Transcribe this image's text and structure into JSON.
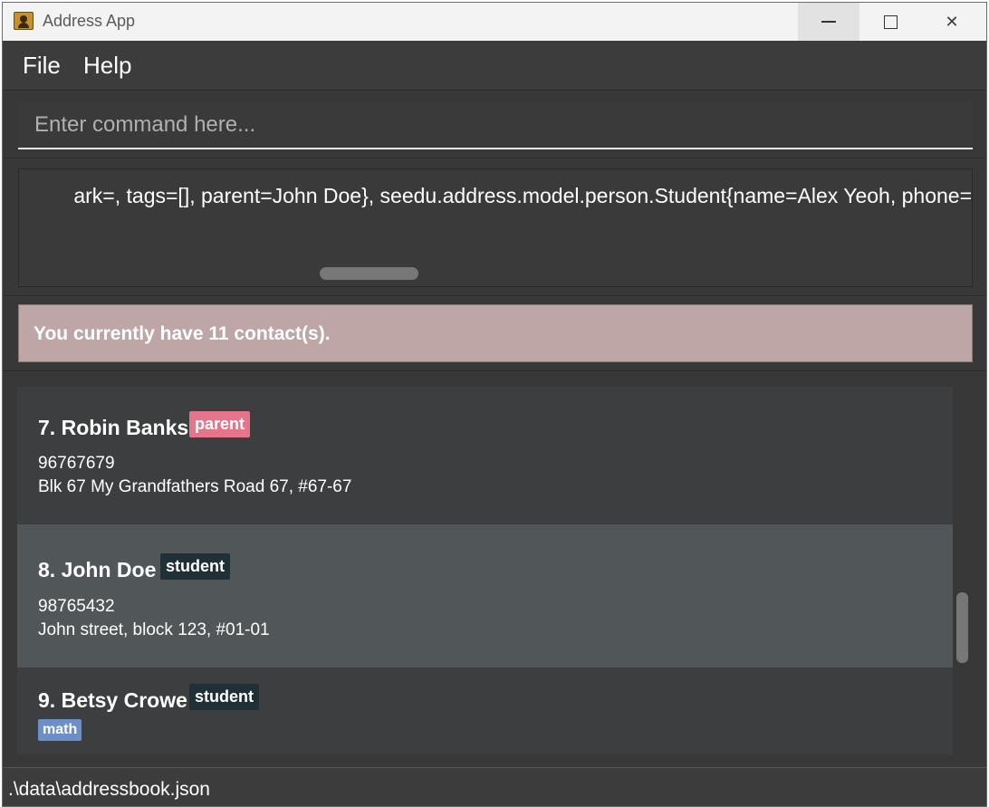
{
  "window": {
    "title": "Address App",
    "icon": "address-book-icon",
    "controls": {
      "minimize": "minimize-icon",
      "maximize": "maximize-icon",
      "close": "✕"
    }
  },
  "menu": {
    "file": "File",
    "help": "Help"
  },
  "command": {
    "placeholder": "Enter command here...",
    "value": ""
  },
  "result": {
    "text": "ark=, tags=[], parent=John Doe}, seedu.address.model.person.Student{name=Alex Yeoh, phone="
  },
  "status_message": "You currently have 11 contact(s).",
  "contacts": [
    {
      "index": "7.",
      "name": "Robin Banks",
      "tag": "parent",
      "phone": "96767679",
      "address": "Blk 67 My Grandfathers Road 67, #67-67"
    },
    {
      "index": "8.",
      "name": "John Doe",
      "tag": "student",
      "phone": "98765432",
      "address": "John street, block 123, #01-01"
    },
    {
      "index": "9.",
      "name": "Betsy Crowe",
      "tag": "student",
      "subject": "math"
    }
  ],
  "colors": {
    "parent_tag": "#e6748a",
    "student_tag": "#1f3037",
    "subject_tag": "#6d8fc8",
    "selected_row": "#515658",
    "status_box": "#bfa6a6"
  },
  "footer": {
    "file_path": ".\\data\\addressbook.json"
  }
}
